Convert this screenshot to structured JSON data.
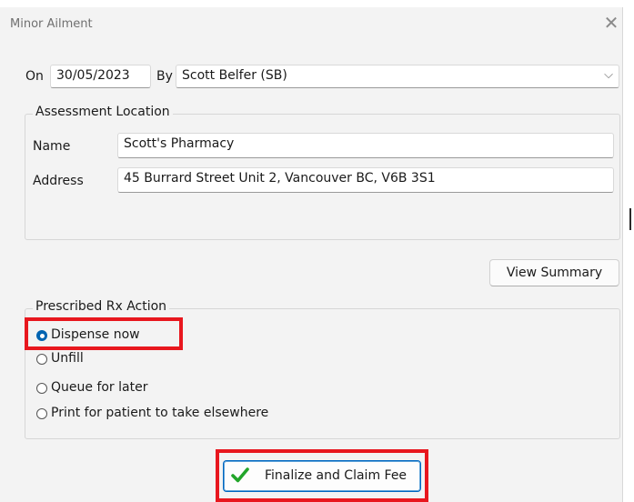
{
  "window": {
    "title": "Minor Ailment",
    "close_symbol": "✕"
  },
  "header": {
    "on_label": "On",
    "date_value": "30/05/2023",
    "by_label": "By",
    "by_value": "Scott Belfer (SB)",
    "by_dropdown_icon": "chevron-down-icon"
  },
  "assessment_location": {
    "title": "Assessment Location",
    "name_label": "Name",
    "name_value": "Scott's Pharmacy",
    "address_label": "Address",
    "address_value": "45 Burrard Street Unit 2, Vancouver BC, V6B 3S1"
  },
  "view_summary_label": "View Summary",
  "prescribed_action": {
    "title": "Prescribed Rx Action",
    "options": [
      {
        "label": "Dispense now",
        "selected": true
      },
      {
        "label": "Unfill",
        "selected": false
      },
      {
        "label": "Queue for later",
        "selected": false
      },
      {
        "label": "Print for patient to take elsewhere",
        "selected": false
      }
    ]
  },
  "finalize_button": {
    "label": "Finalize and Claim Fee",
    "icon": "green-checkmark-icon"
  },
  "colors": {
    "highlight": "#e8171e",
    "accent": "#0063b1",
    "check": "#22a52a",
    "dialog_bg": "#f3f3f3"
  }
}
